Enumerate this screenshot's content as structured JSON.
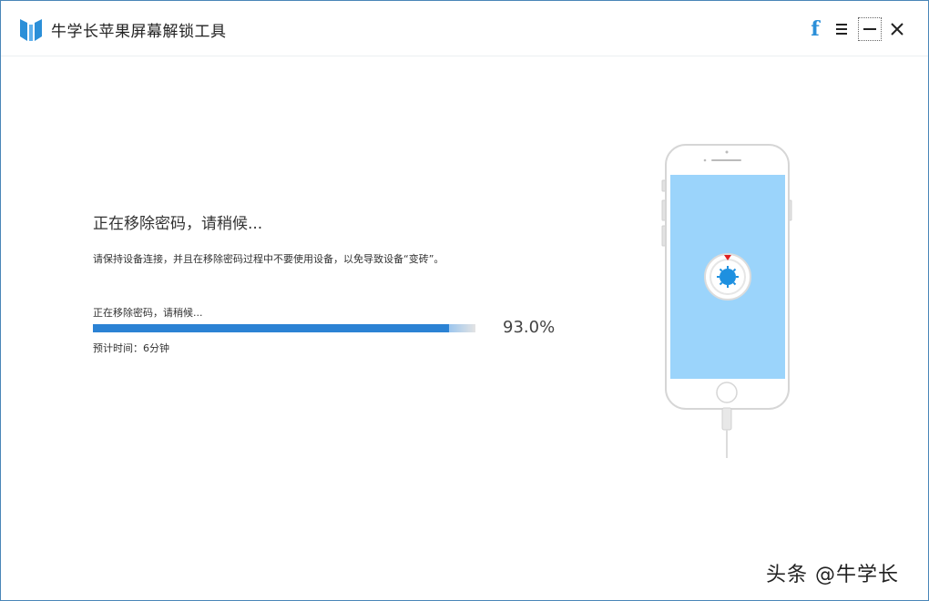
{
  "app": {
    "title": "牛学长苹果屏幕解锁工具",
    "brand_color": "#2b8fd8"
  },
  "titlebar": {
    "icons": [
      "facebook-icon",
      "menu-icon",
      "minimize-icon",
      "close-icon"
    ]
  },
  "main": {
    "heading": "正在移除密码，请稍候...",
    "description": "请保持设备连接，并且在移除密码过程中不要使用设备，以免导致设备“变砖”。",
    "progress": {
      "label": "正在移除密码，请稍候...",
      "percent_text": "93.0%",
      "value_fraction": 0.93,
      "time_label": "预计时间：6分钟",
      "fill_color": "#2b82d4",
      "track_color": "#e3e3e3"
    }
  },
  "illustration": {
    "device": "iphone",
    "screen_color": "#9bd4fb",
    "gear_color": "#1e90e0",
    "marker_color": "#e02020"
  },
  "watermark": {
    "text": "头条 @牛学长"
  }
}
